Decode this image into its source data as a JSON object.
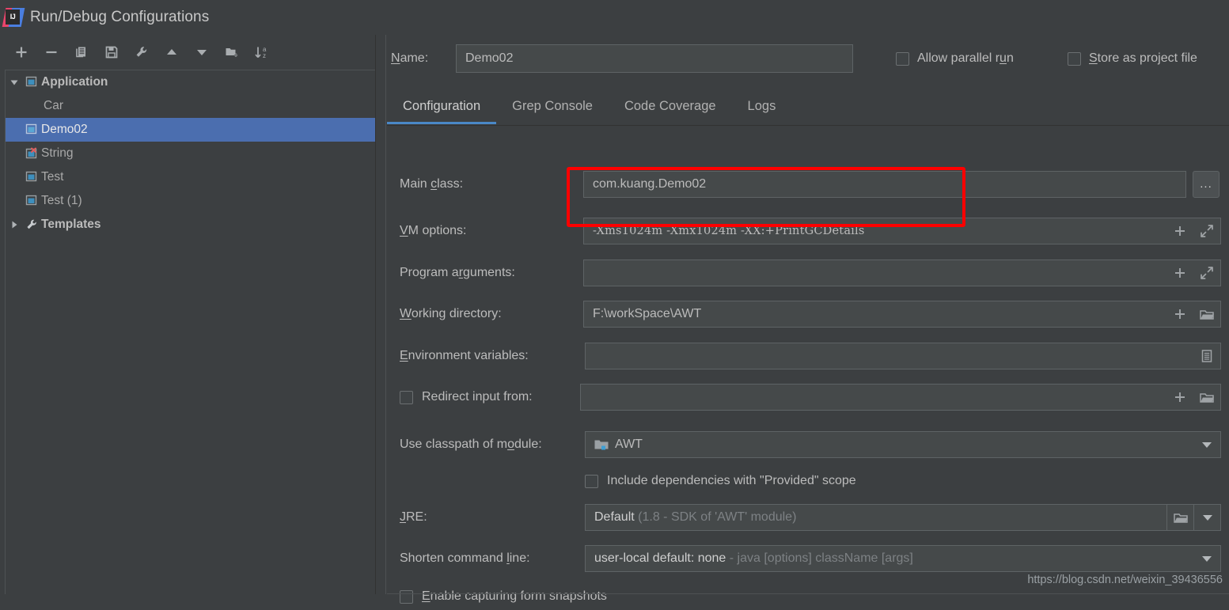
{
  "window": {
    "title": "Run/Debug Configurations",
    "logo_icon": "intellij-idea-logo"
  },
  "colors": {
    "background": "#3c3f41",
    "field_background": "#45494a",
    "selection_blue": "#4b6eaf",
    "tab_accent": "#4a88c7",
    "annotation_red": "#fe0000",
    "text": "#bbbbbb",
    "text_dim": "#7d8184"
  },
  "toolbar": {
    "buttons": [
      {
        "name": "add-configuration",
        "icon": "plus-icon"
      },
      {
        "name": "remove-configuration",
        "icon": "minus-icon"
      },
      {
        "name": "copy-configuration",
        "icon": "copy-icon"
      },
      {
        "name": "save-configuration",
        "icon": "save-icon"
      },
      {
        "name": "edit-templates",
        "icon": "wrench-icon"
      },
      {
        "name": "move-up",
        "icon": "arrow-up-icon"
      },
      {
        "name": "move-down",
        "icon": "arrow-down-icon"
      },
      {
        "name": "new-folder",
        "icon": "folder-add-icon"
      },
      {
        "name": "sort-alphabetically",
        "icon": "sort-az-icon"
      }
    ]
  },
  "tree": {
    "nodes": [
      {
        "label": "Application",
        "level": 0,
        "bold": true,
        "twisty": "expanded",
        "icon": "application-icon",
        "selected": false
      },
      {
        "label": "Car",
        "level": 1,
        "bold": false,
        "twisty": "none",
        "icon": "none",
        "selected": false
      },
      {
        "label": "Demo02",
        "level": 1,
        "bold": false,
        "twisty": "none",
        "icon": "application-icon",
        "selected": true
      },
      {
        "label": "String",
        "level": 1,
        "bold": false,
        "twisty": "none",
        "icon": "application-error-icon",
        "selected": false
      },
      {
        "label": "Test",
        "level": 1,
        "bold": false,
        "twisty": "none",
        "icon": "application-icon",
        "selected": false
      },
      {
        "label": "Test (1)",
        "level": 1,
        "bold": false,
        "twisty": "none",
        "icon": "application-icon",
        "selected": false
      },
      {
        "label": "Templates",
        "level": 0,
        "bold": true,
        "twisty": "collapsed",
        "icon": "wrench-icon",
        "selected": false
      }
    ]
  },
  "header": {
    "name_label_pre": "N",
    "name_label_post": "ame:",
    "name_value": "Demo02",
    "allow_parallel_run": {
      "pre": "Allow parallel r",
      "mnemonic": "u",
      "post": "n",
      "checked": false
    },
    "store_as_project_file": {
      "pre": "",
      "mnemonic": "S",
      "post": "tore as project file",
      "checked": false
    }
  },
  "tabs": [
    {
      "label": "Configuration",
      "active": true
    },
    {
      "label": "Grep Console",
      "active": false
    },
    {
      "label": "Code Coverage",
      "active": false
    },
    {
      "label": "Logs",
      "active": false
    }
  ],
  "form": {
    "main_class": {
      "label_pre": "Main ",
      "label_mnemonic": "c",
      "label_post": "lass:",
      "value": "com.kuang.Demo02",
      "browse_button": "..."
    },
    "vm_options": {
      "label_pre": "",
      "label_mnemonic": "V",
      "label_post": "M options:",
      "value": "-Xms1024m -Xmx1024m -XX:+PrintGCDetails",
      "placeholder": ""
    },
    "program_arguments": {
      "label_pre": "Program a",
      "label_mnemonic": "r",
      "label_post": "guments:",
      "value": "",
      "placeholder": ""
    },
    "working_directory": {
      "label_pre": "",
      "label_mnemonic": "W",
      "label_post": "orking directory:",
      "value": "F:\\workSpace\\AWT",
      "placeholder": ""
    },
    "environment_variables": {
      "label_pre": "",
      "label_mnemonic": "E",
      "label_post": "nvironment variables:",
      "value": "",
      "placeholder": ""
    },
    "redirect_input_from": {
      "label": "Redirect input from:",
      "checked": false,
      "value": "",
      "placeholder": ""
    },
    "use_classpath_of_module": {
      "label_pre": "Use classpath of m",
      "label_mnemonic": "o",
      "label_post": "dule:",
      "value": "AWT"
    },
    "include_provided": {
      "label": "Include dependencies with \"Provided\" scope",
      "checked": false
    },
    "jre": {
      "label_pre": "",
      "label_mnemonic": "J",
      "label_post": "RE:",
      "value_strong": "Default",
      "value_dim": "(1.8 - SDK of 'AWT' module)"
    },
    "shorten_command_line": {
      "label_pre": "Shorten command ",
      "label_mnemonic": "l",
      "label_post": "ine:",
      "value_strong": "user-local default: none",
      "value_dim": "- java [options] className [args]"
    },
    "enable_form_snapshots": {
      "pre": "",
      "mnemonic": "E",
      "post": "nable capturing form snapshots",
      "checked": false
    }
  },
  "annotation": {
    "target": "vm-options-row",
    "color": "#fe0000"
  },
  "watermark": {
    "text": "https://blog.csdn.net/weixin_39436556"
  }
}
